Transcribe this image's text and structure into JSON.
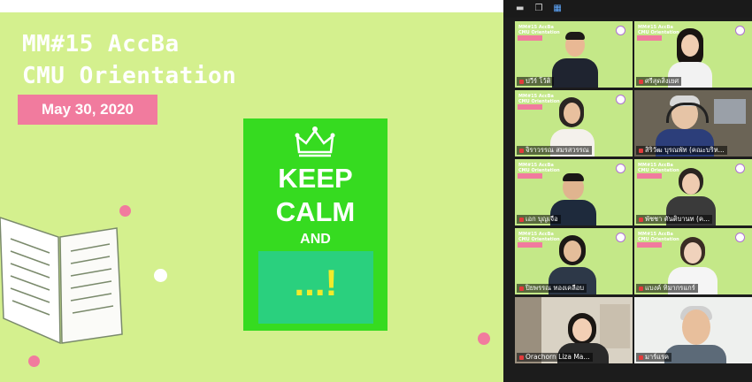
{
  "slide": {
    "title_line1": "MM#15 AccBa",
    "title_line2": "CMU Orientation",
    "date": "May 30, 2020",
    "poster": {
      "line1": "KEEP",
      "line2": "CALM",
      "line3": "AND",
      "box_text": "...!"
    },
    "colors": {
      "background": "#d4f08e",
      "badge": "#f17b9e",
      "poster": "#36db20",
      "poster_box": "#2ad07e",
      "poster_box_text": "#f2ea2b"
    }
  },
  "meeting": {
    "toolbar_icons": [
      "minimize-icon",
      "restore-icon",
      "gallery-grid-icon"
    ],
    "participants": [
      {
        "name": "ปวีร์ โว้ติ",
        "muted": true
      },
      {
        "name": "ศรีสุดสิ่งเยศ",
        "muted": true
      },
      {
        "name": "จิราวรรณ สมรสวรรณ",
        "muted": true
      },
      {
        "name": "สิริวัฒ บุรณพัท (คณะบริห...",
        "muted": true
      },
      {
        "name": "เอก บุญเจือ",
        "muted": true
      },
      {
        "name": "พัชชา ตันติบานท (ค...",
        "muted": true
      },
      {
        "name": "ปิยพรรณ ทองเคลือบ",
        "muted": true
      },
      {
        "name": "แบงค์ ทิมากรแกร์",
        "muted": true
      },
      {
        "name": "Orachorn Liza Ma...",
        "muted": true
      },
      {
        "name": "มาร์แรค",
        "muted": true
      }
    ]
  }
}
